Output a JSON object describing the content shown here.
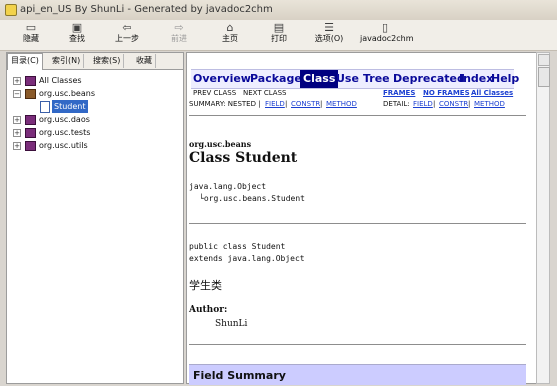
{
  "window": {
    "title": "api_en_US By ShunLi - Generated by javadoc2chm"
  },
  "toolbar": {
    "buttons": [
      {
        "label": "隐藏",
        "icon": "hide-icon"
      },
      {
        "label": "查找",
        "icon": "locate-icon"
      },
      {
        "label": "上一步",
        "icon": "back-icon"
      },
      {
        "label": "前进",
        "icon": "forward-icon",
        "disabled": true
      },
      {
        "label": "主页",
        "icon": "home-icon"
      },
      {
        "label": "打印",
        "icon": "print-icon"
      },
      {
        "label": "选项(O)",
        "icon": "options-icon"
      },
      {
        "label": "javadoc2chm",
        "icon": "javadoc2chm-icon"
      }
    ]
  },
  "left_panel": {
    "tabs": [
      "目录(C)",
      "索引(N)",
      "搜索(S)",
      "收藏"
    ],
    "tree": [
      {
        "label": "All Classes",
        "expander": "+"
      },
      {
        "label": "org.usc.beans",
        "expander": "−"
      },
      {
        "label": "Student",
        "selected": true
      },
      {
        "label": "org.usc.daos",
        "expander": "+"
      },
      {
        "label": "org.usc.tests",
        "expander": "+"
      },
      {
        "label": "org.usc.utils",
        "expander": "+"
      }
    ]
  },
  "content": {
    "nav": [
      "Overview",
      "Package",
      "Class",
      "Use",
      "Tree",
      "Deprecated",
      "Index",
      "Help"
    ],
    "active_nav": "Class",
    "prev_class": "PREV CLASS",
    "next_class": "NEXT CLASS",
    "frames": "FRAMES",
    "no_frames": "NO FRAMES",
    "all_classes": "All Classes",
    "summary_label": "SUMMARY: NESTED |",
    "detail_label": "DETAIL:",
    "links": {
      "field": "FIELD",
      "constr": "CONSTR",
      "method": "METHOD"
    },
    "package": "org.usc.beans",
    "class_title": "Class Student",
    "hierarchy_root": "java.lang.Object",
    "hierarchy_child": "└org.usc.beans.Student",
    "decl_line1": "public class Student",
    "decl_line2": "extends java.lang.Object",
    "description": "学生类",
    "author_label": "Author:",
    "author_name": "ShunLi",
    "section_heading": "Field Summary"
  }
}
